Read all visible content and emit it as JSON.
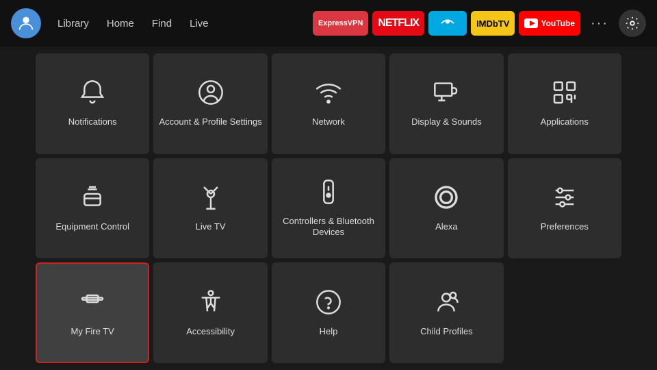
{
  "nav": {
    "links": [
      {
        "label": "Library",
        "name": "library"
      },
      {
        "label": "Home",
        "name": "home"
      },
      {
        "label": "Find",
        "name": "find"
      },
      {
        "label": "Live",
        "name": "live"
      }
    ],
    "apps": [
      {
        "label": "ExpressVPN",
        "class": "app-expressvpn",
        "name": "expressvpn"
      },
      {
        "label": "NETFLIX",
        "class": "app-netflix",
        "name": "netflix"
      },
      {
        "label": "≈",
        "class": "app-prime",
        "name": "prime-video"
      },
      {
        "label": "IMDbTV",
        "class": "app-imdb",
        "name": "imdb-tv"
      },
      {
        "label": "▶ YouTube",
        "class": "app-youtube",
        "name": "youtube"
      }
    ],
    "more_label": "···",
    "settings_label": "⚙"
  },
  "grid": {
    "items": [
      {
        "label": "Notifications",
        "icon": "bell",
        "name": "notifications",
        "selected": false
      },
      {
        "label": "Account & Profile Settings",
        "icon": "person-circle",
        "name": "account-profile",
        "selected": false
      },
      {
        "label": "Network",
        "icon": "wifi",
        "name": "network",
        "selected": false
      },
      {
        "label": "Display & Sounds",
        "icon": "monitor-sound",
        "name": "display-sounds",
        "selected": false
      },
      {
        "label": "Applications",
        "icon": "apps-grid",
        "name": "applications",
        "selected": false
      },
      {
        "label": "Equipment Control",
        "icon": "tv-remote",
        "name": "equipment-control",
        "selected": false
      },
      {
        "label": "Live TV",
        "icon": "antenna",
        "name": "live-tv",
        "selected": false
      },
      {
        "label": "Controllers & Bluetooth Devices",
        "icon": "remote",
        "name": "controllers-bluetooth",
        "selected": false
      },
      {
        "label": "Alexa",
        "icon": "alexa-ring",
        "name": "alexa",
        "selected": false
      },
      {
        "label": "Preferences",
        "icon": "sliders",
        "name": "preferences",
        "selected": false
      },
      {
        "label": "My Fire TV",
        "icon": "firetv",
        "name": "my-fire-tv",
        "selected": true
      },
      {
        "label": "Accessibility",
        "icon": "accessibility",
        "name": "accessibility",
        "selected": false
      },
      {
        "label": "Help",
        "icon": "help-circle",
        "name": "help",
        "selected": false
      },
      {
        "label": "Child Profiles",
        "icon": "child-profile",
        "name": "child-profiles",
        "selected": false
      }
    ]
  }
}
